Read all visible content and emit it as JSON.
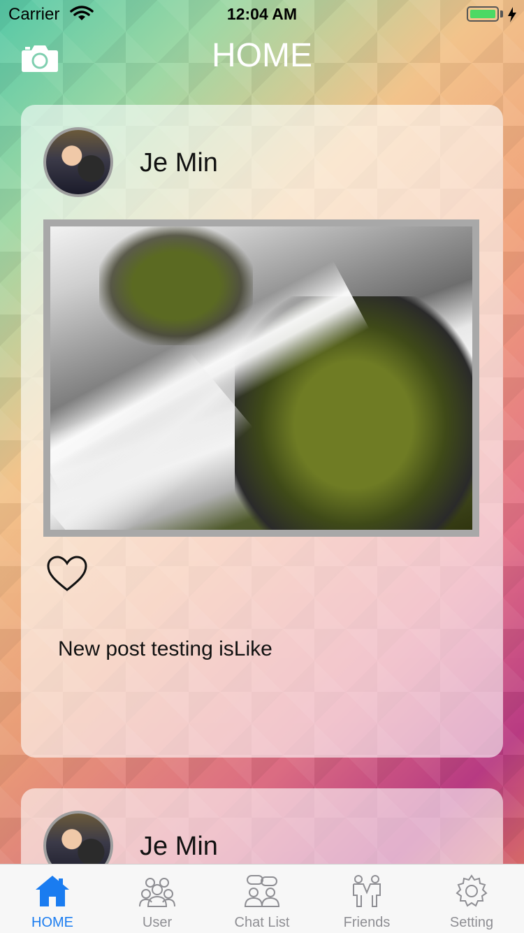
{
  "status_bar": {
    "carrier": "Carrier",
    "time": "12:04 AM"
  },
  "header": {
    "title": "HOME",
    "camera_icon": "camera-icon"
  },
  "posts": [
    {
      "author": "Je Min",
      "text": "New post testing isLike",
      "liked": false
    },
    {
      "author": "Je Min"
    }
  ],
  "tabbar": {
    "items": [
      {
        "label": "HOME",
        "icon": "home-icon",
        "active": true
      },
      {
        "label": "User",
        "icon": "users-icon",
        "active": false
      },
      {
        "label": "Chat List",
        "icon": "chat-icon",
        "active": false
      },
      {
        "label": "Friends",
        "icon": "friends-icon",
        "active": false
      },
      {
        "label": "Setting",
        "icon": "gear-icon",
        "active": false
      }
    ]
  },
  "colors": {
    "accent": "#1a7cf0",
    "tab_inactive": "#8e8e93",
    "battery": "#4cd964"
  }
}
